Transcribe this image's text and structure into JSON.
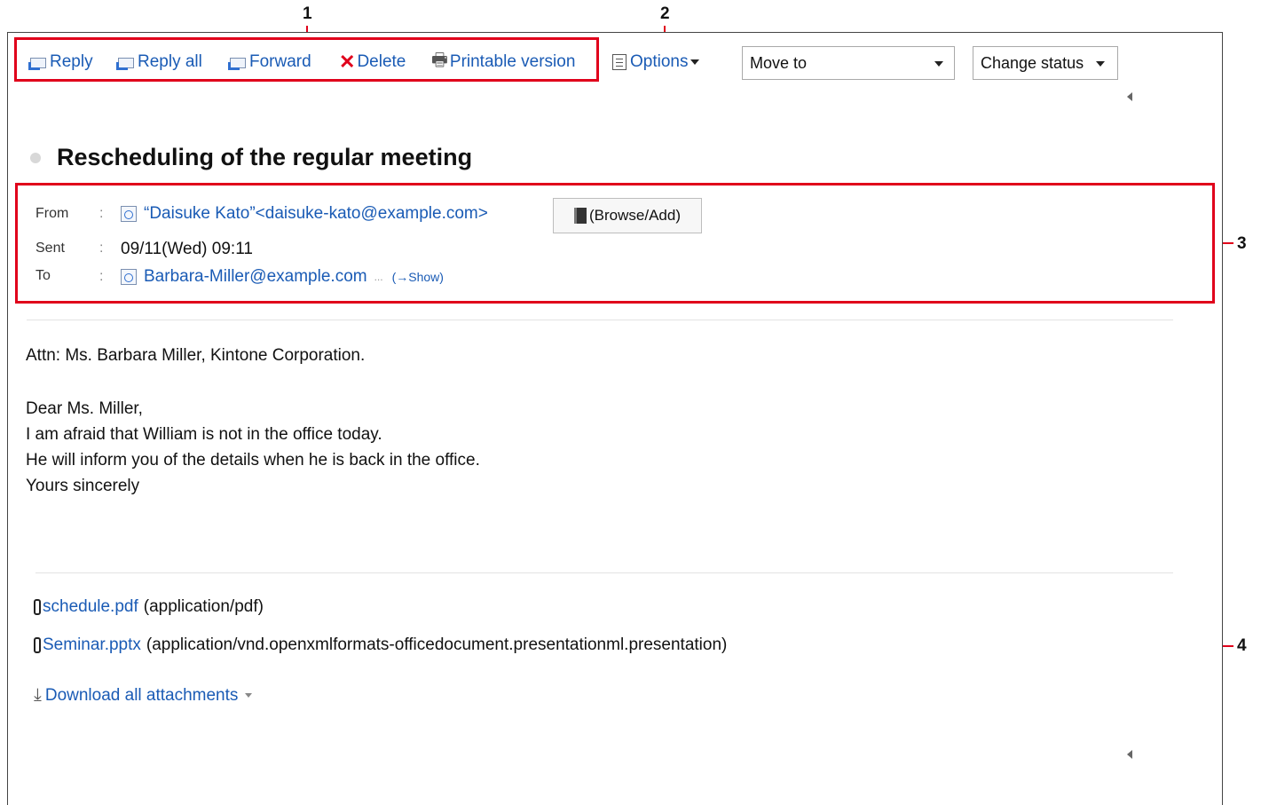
{
  "callouts": [
    "1",
    "2",
    "3",
    "4"
  ],
  "toolbar": {
    "reply": "Reply",
    "reply_all": "Reply all",
    "forward": "Forward",
    "delete": "Delete",
    "printable": "Printable version",
    "options": "Options",
    "move_to": "Move to",
    "change_status": "Change status"
  },
  "message": {
    "subject": "Rescheduling of the regular meeting",
    "from_label": "From",
    "from_value": "“Daisuke Kato”<daisuke-kato@example.com>",
    "browse_add": "(Browse/Add)",
    "sent_label": "Sent",
    "sent_value": "09/11(Wed) 09:11",
    "to_label": "To",
    "to_value": "Barbara-Miller@example.com",
    "to_ellipsis": "...",
    "show_link": "(→Show)",
    "colon": ":"
  },
  "body": [
    "Attn: Ms. Barbara Miller, Kintone Corporation.",
    "Dear Ms. Miller,",
    "I am afraid that William is not in the office today.",
    "He will inform you of the details when he is back in the office.",
    "Yours sincerely"
  ],
  "attachments": [
    {
      "name": "schedule.pdf",
      "mime": "(application/pdf)"
    },
    {
      "name": "Seminar.pptx",
      "mime": "(application/vnd.openxmlformats-officedocument.presentationml.presentation)"
    }
  ],
  "download_all": "Download all attachments",
  "colors": {
    "callout_red": "#e0001b",
    "link_blue": "#1a5bb5"
  }
}
